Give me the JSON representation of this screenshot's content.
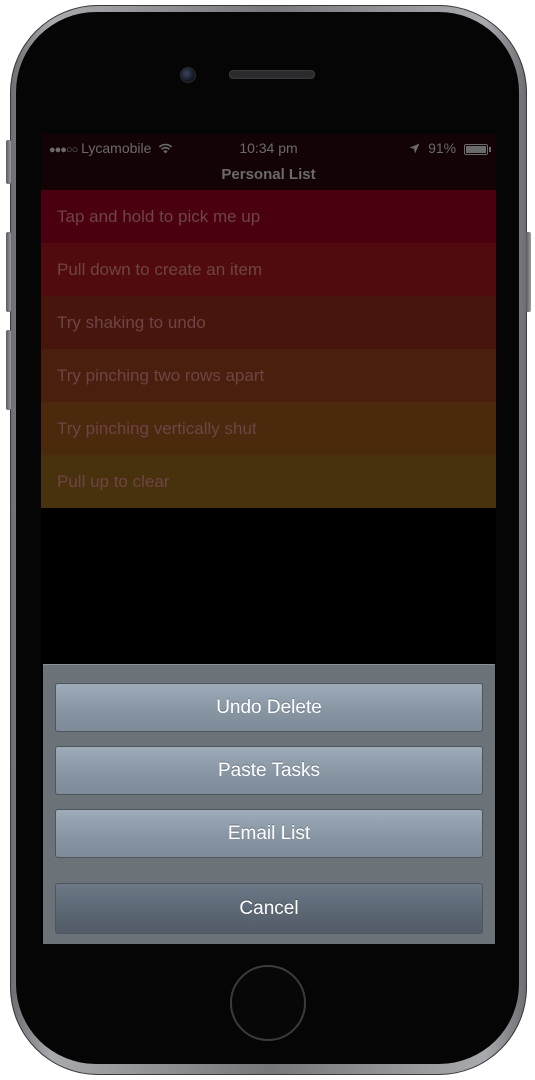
{
  "status_bar": {
    "signal": "●●●○○",
    "carrier": "Lycamobile",
    "wifi_icon": "wifi-icon",
    "time": "10:34 pm",
    "location_icon": "location-arrow-icon",
    "battery": "91%"
  },
  "list": {
    "title": "Personal List",
    "items": [
      {
        "label": "Tap and hold to pick me up",
        "color": "#4b000f"
      },
      {
        "label": "Pull down to create an item",
        "color": "#510a0e"
      },
      {
        "label": "Try shaking to undo",
        "color": "#48150d"
      },
      {
        "label": "Try pinching two rows apart",
        "color": "#4b1f0e"
      },
      {
        "label": "Try pinching vertically shut",
        "color": "#4a290d"
      },
      {
        "label": "Pull up to clear",
        "color": "#47320d"
      }
    ]
  },
  "action_sheet": {
    "undo_delete": "Undo Delete",
    "paste_tasks": "Paste Tasks",
    "email_list": "Email List",
    "cancel": "Cancel"
  }
}
